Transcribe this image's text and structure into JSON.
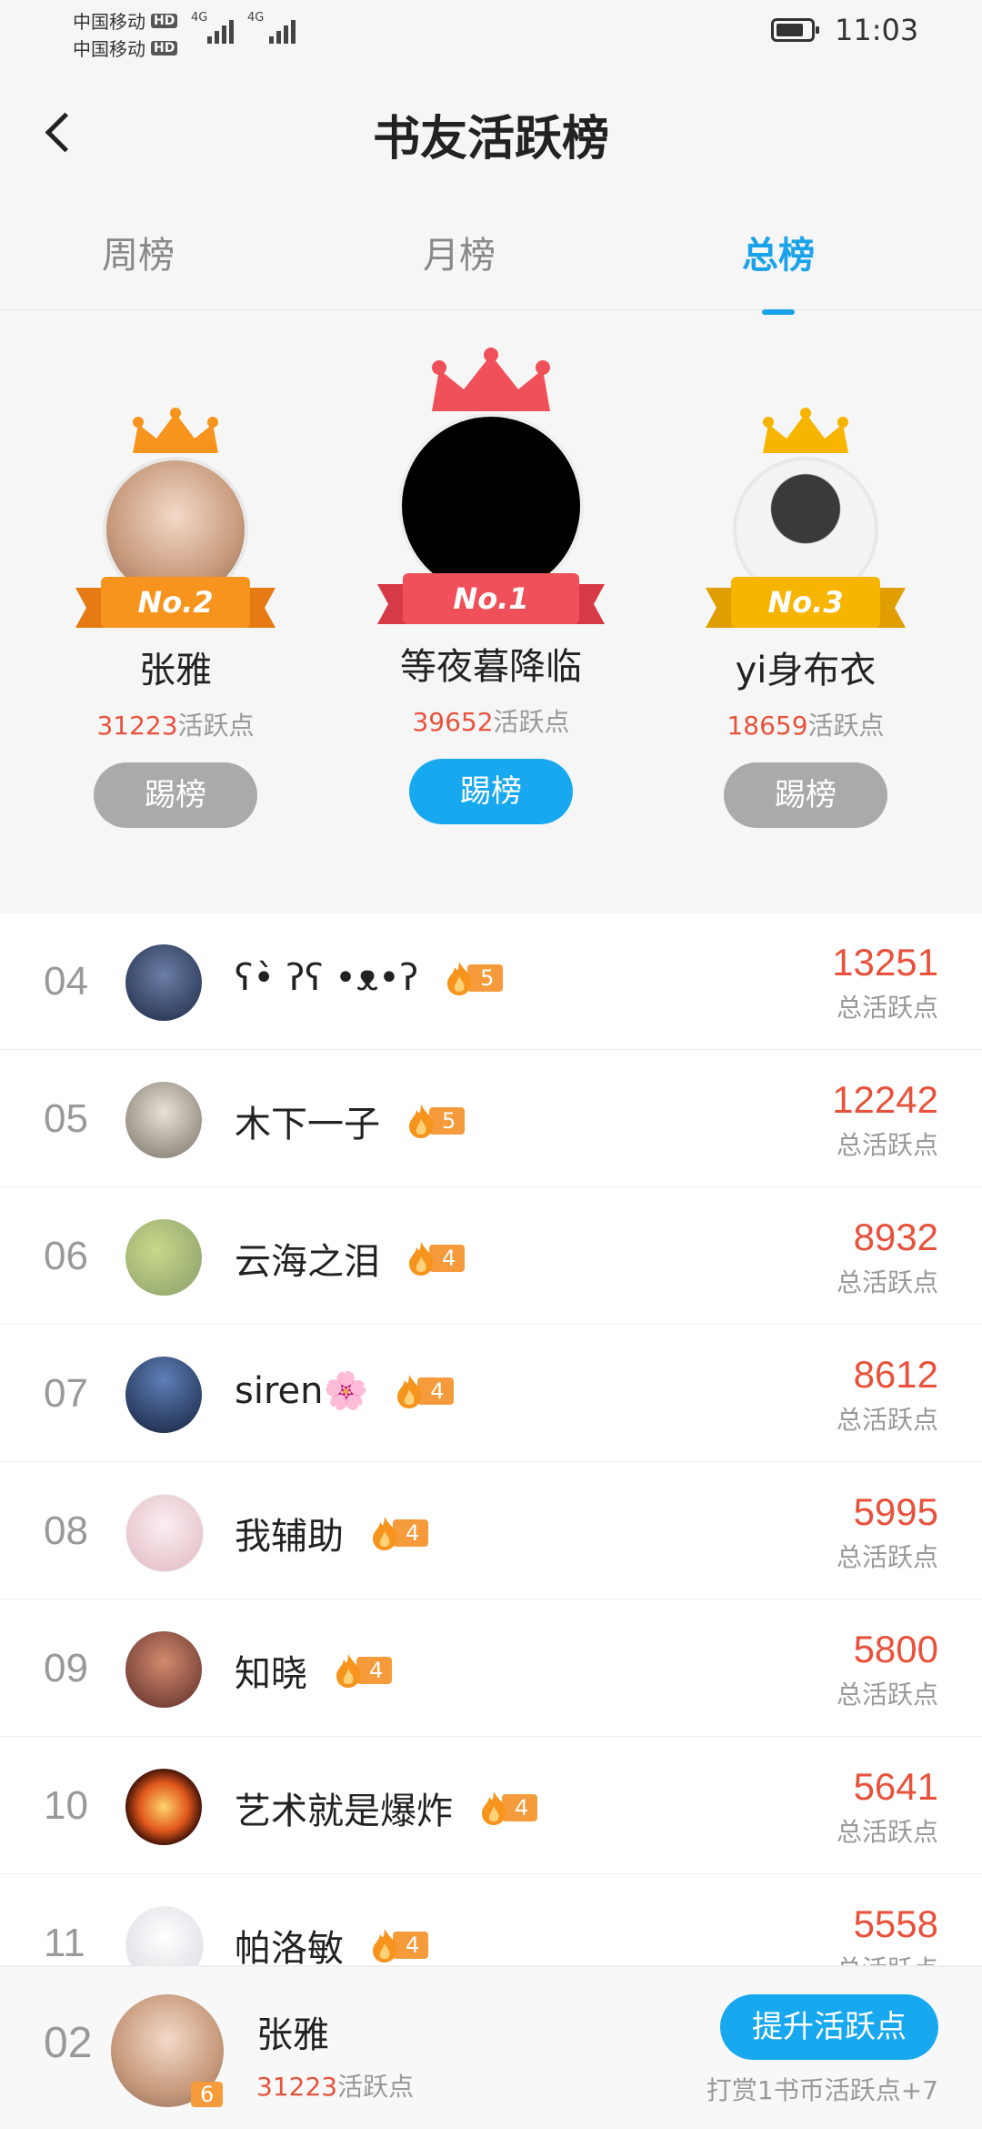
{
  "status": {
    "carrier1": "中国移动",
    "carrier2": "中国移动",
    "hd": "HD",
    "net1": "4G",
    "net2": "4G",
    "time": "11:03"
  },
  "header": {
    "title": "书友活跃榜"
  },
  "tabs": [
    {
      "label": "周榜",
      "active": false
    },
    {
      "label": "月榜",
      "active": false
    },
    {
      "label": "总榜",
      "active": true
    }
  ],
  "podium": {
    "second": {
      "rank_label": "No.2",
      "name": "张雅",
      "points": "31223",
      "points_suffix": "活跃点",
      "button": "踢榜"
    },
    "first": {
      "rank_label": "No.1",
      "name": "等夜暮降临",
      "points": "39652",
      "points_suffix": "活跃点",
      "button": "踢榜"
    },
    "third": {
      "rank_label": "No.3",
      "name": "yi身布衣",
      "points": "18659",
      "points_suffix": "活跃点",
      "button": "踢榜"
    }
  },
  "list": {
    "score_label": "总活跃点",
    "rows": [
      {
        "rank": "04",
        "name": "ʕ•̀ ʔʕ •ᴥ•ʔ",
        "level": "5",
        "score": "13251"
      },
      {
        "rank": "05",
        "name": "木下一子",
        "level": "5",
        "score": "12242"
      },
      {
        "rank": "06",
        "name": "云海之泪",
        "level": "4",
        "score": "8932"
      },
      {
        "rank": "07",
        "name": "siren🌸",
        "level": "4",
        "score": "8612"
      },
      {
        "rank": "08",
        "name": "我辅助",
        "level": "4",
        "score": "5995"
      },
      {
        "rank": "09",
        "name": "知晓",
        "level": "4",
        "score": "5800"
      },
      {
        "rank": "10",
        "name": "艺术就是爆炸",
        "level": "4",
        "score": "5641"
      },
      {
        "rank": "11",
        "name": "帕洛敏",
        "level": "4",
        "score": "5558"
      }
    ]
  },
  "me": {
    "rank": "02",
    "name": "张雅",
    "level": "6",
    "points": "31223",
    "points_suffix": "活跃点",
    "button": "提升活跃点",
    "hint": "打赏1书币活跃点+7"
  },
  "colors": {
    "accent": "#17a8f0",
    "score": "#e8523c",
    "gold": "#f7b500",
    "silver_orange": "#f7941d",
    "first_red": "#f0505a"
  }
}
